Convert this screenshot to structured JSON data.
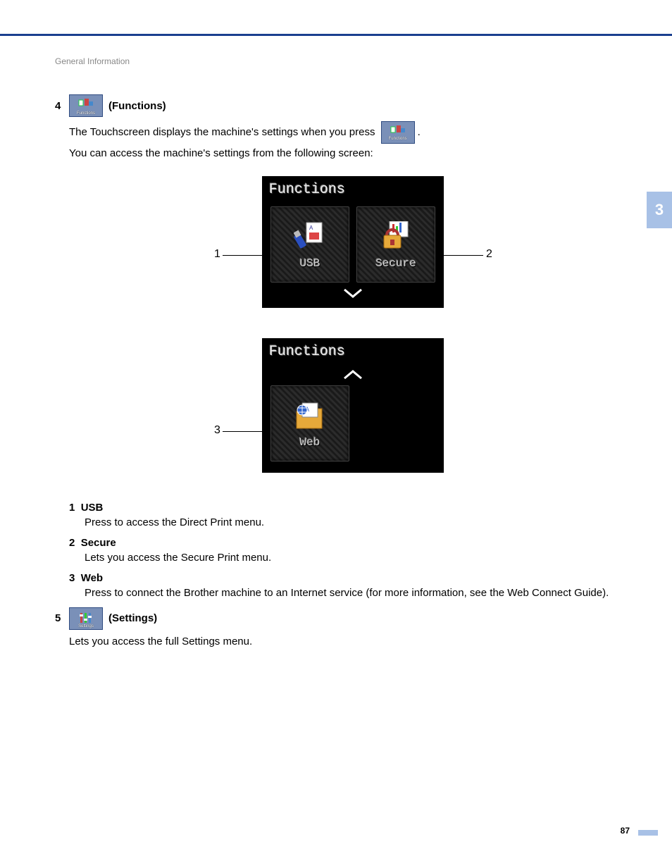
{
  "breadcrumb": "General Information",
  "chapter_tab": "3",
  "page_number": "87",
  "step4": {
    "num": "4",
    "icon_caption": "Functions",
    "title": " (Functions)",
    "para1_a": "The Touchscreen displays the machine's settings when you press ",
    "para1_b": ".",
    "para2": "You can access the machine's settings from the following screen:",
    "screen_title": "Functions",
    "tile_usb": "USB",
    "tile_secure": "Secure",
    "tile_web": "Web",
    "callout_1": "1",
    "callout_2": "2",
    "callout_3": "3",
    "list": [
      {
        "num": "1",
        "head": "USB",
        "body": "Press to access the Direct Print menu."
      },
      {
        "num": "2",
        "head": "Secure",
        "body": "Lets you access the Secure Print menu."
      },
      {
        "num": "3",
        "head": "Web",
        "body": "Press to connect the Brother machine to an Internet service (for more information, see the Web Connect Guide)."
      }
    ]
  },
  "step5": {
    "num": "5",
    "icon_caption": "Settings",
    "title": " (Settings)",
    "para": "Lets you access the full Settings menu."
  }
}
